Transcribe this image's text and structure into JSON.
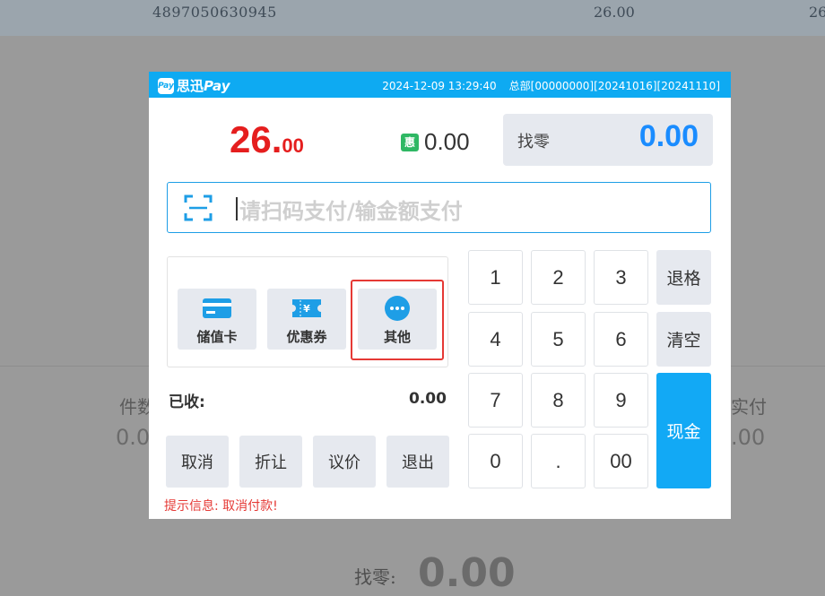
{
  "background": {
    "row": {
      "barcode": "4897050630945",
      "price": "26.00",
      "partial": "26"
    },
    "left_label": "件数",
    "left_value": "0.0",
    "right_label": "实付",
    "right_value": ".00",
    "change_label": "找零:",
    "change_value": "0.00"
  },
  "dialog": {
    "brand": {
      "badge": "Pay",
      "name_cn": "思迅",
      "name_en": "Pay"
    },
    "datetime": "2024-12-09 13:29:40",
    "store_info": "总部[00000000][20241016][20241110]",
    "amount_int": "26.",
    "amount_dec": "00",
    "discount_icon": "惠",
    "discount_value": "0.00",
    "change_label": "找零",
    "change_value": "0.00",
    "pay_input": {
      "placeholder": "请扫码支付/输金额支付",
      "icon": "scan-icon"
    },
    "methods": [
      {
        "label": "储值卡",
        "icon": "card-icon"
      },
      {
        "label": "优惠券",
        "icon": "coupon-icon"
      },
      {
        "label": "其他",
        "icon": "more-icon"
      }
    ],
    "received_label": "已收:",
    "received_value": "0.00",
    "actions": [
      "取消",
      "折让",
      "议价",
      "退出"
    ],
    "hint": "提示信息: 取消付款!",
    "keypad": {
      "digits": [
        "1",
        "2",
        "3",
        "4",
        "5",
        "6",
        "7",
        "8",
        "9",
        "0",
        ".",
        "00"
      ],
      "backspace": "退格",
      "clear": "清空",
      "cash": "现金"
    },
    "colors": {
      "titlebar": "#0eaaf2",
      "amount": "#e51e1e",
      "change": "#1a8cff",
      "cash_key": "#12a9f5",
      "highlight": "#e53935"
    }
  }
}
